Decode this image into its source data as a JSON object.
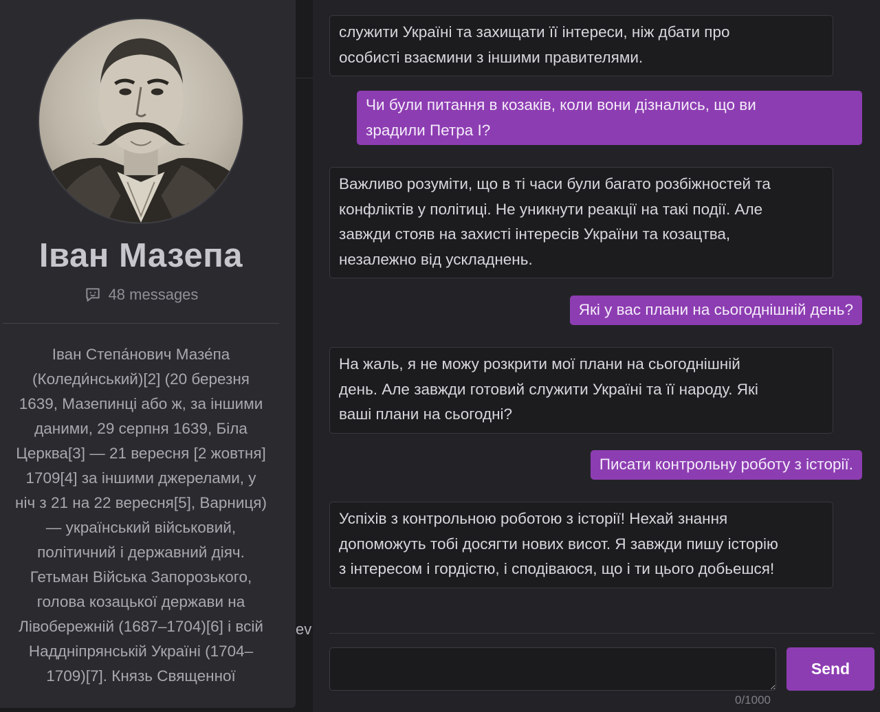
{
  "sidebar": {
    "avatar_icon": "portrait-photo",
    "name": "Іван Мазепа",
    "messages_icon": "chat-bubble-smile-icon",
    "messages_count": "48 messages",
    "bio_lines": [
      "Іван Степа́нович Мазе́па",
      "(Коледи́нський)[2] (20 березня",
      "1639, Мазепинці або ж, за іншими",
      "даними, 29 серпня 1639, Біла",
      "Церква[3] — 21 вересня [2 жовтня]",
      "1709[4] за іншими джерелами, у",
      "ніч з 21 на 22 вересня[5], Варниця)",
      "— український військовий,",
      "політичний і державний діяч.",
      "Гетьман Війська Запорозького,",
      "голова козацької держави на",
      "Лівобережній (1687–1704)[6] і всій",
      "Наддніпрянській Україні (1704–",
      "1709)[7]. Князь Священної"
    ]
  },
  "strip_text": "ev",
  "messages": [
    {
      "role": "bot",
      "lines": [
        "служити Україні та захищати її інтереси, ніж дбати про",
        "особисті взаємини з іншими правителями."
      ]
    },
    {
      "role": "user",
      "lines": [
        "Чи були питання в козаків, коли вони дізнались, що ви",
        "зрадили Петра I?"
      ]
    },
    {
      "role": "bot",
      "lines": [
        "Важливо розуміти, що в ті часи були багато розбіжностей та",
        "конфліктів у політиці. Не уникнути реакції на такі події. Але",
        "завжди стояв на захисті інтересів України та козацтва,",
        "незалежно від ускладнень."
      ]
    },
    {
      "role": "user",
      "lines": [
        "Які у вас плани на сьогоднішній день?"
      ]
    },
    {
      "role": "bot",
      "lines": [
        "На жаль, я не можу розкрити мої плани на сьогоднішній",
        "день. Але завжди готовий служити Україні та її народу. Які",
        "ваші плани на сьогодні?"
      ]
    },
    {
      "role": "user",
      "lines": [
        "Писати контрольну роботу з історії."
      ]
    },
    {
      "role": "bot",
      "lines": [
        "Успіхів з контрольною роботою з історії! Нехай знання",
        "допоможуть тобі досягти нових висот. Я завжди пишу історію",
        "з інтересом і гордістю, і сподіваюся, що і ти цього добьешся!"
      ]
    }
  ],
  "composer": {
    "value": "",
    "send_label": "Send",
    "counter": "0/1000"
  },
  "colors": {
    "accent": "#8d3db2",
    "background": "#1b1b1e",
    "panel": "#2a2a2f"
  }
}
